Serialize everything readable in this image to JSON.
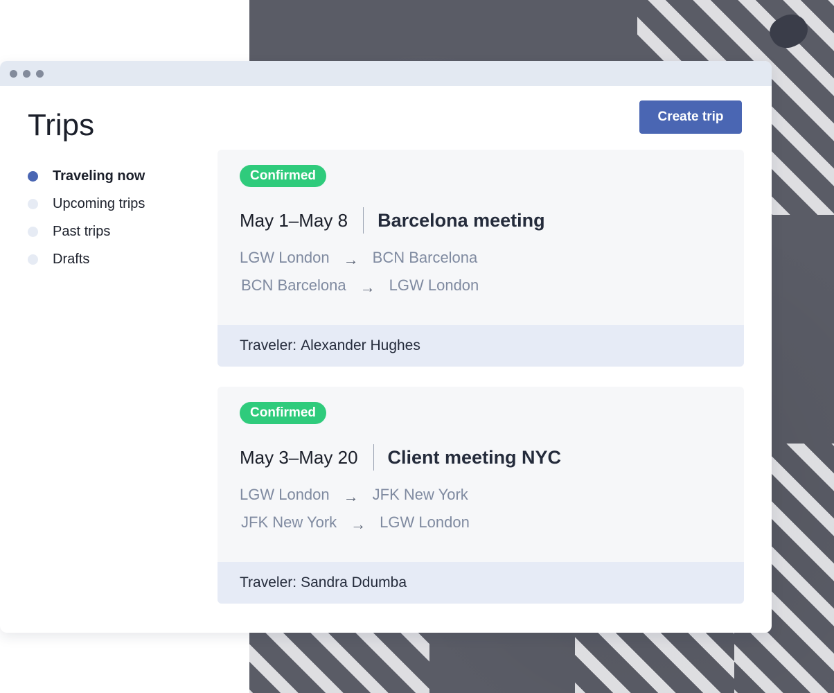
{
  "page": {
    "title": "Trips"
  },
  "actions": {
    "create_label": "Create trip"
  },
  "sidebar": {
    "items": [
      {
        "label": "Traveling now",
        "active": true
      },
      {
        "label": "Upcoming trips",
        "active": false
      },
      {
        "label": "Past trips",
        "active": false
      },
      {
        "label": "Drafts",
        "active": false
      }
    ]
  },
  "trips": [
    {
      "status": "Confirmed",
      "dates": "May 1–May 8",
      "name": "Barcelona meeting",
      "legs": [
        {
          "from": "LGW London",
          "to": "BCN Barcelona"
        },
        {
          "from": "BCN Barcelona",
          "to": "LGW London"
        }
      ],
      "traveler_label": "Traveler:",
      "traveler": "Alexander Hughes"
    },
    {
      "status": "Confirmed",
      "dates": "May 3–May 20",
      "name": "Client meeting NYC",
      "legs": [
        {
          "from": "LGW London",
          "to": "JFK New York"
        },
        {
          "from": "JFK New York",
          "to": "LGW London"
        }
      ],
      "traveler_label": "Traveler:",
      "traveler": "Sandra Ddumba"
    }
  ],
  "icons": {
    "route_arrow": "arrow-right-icon",
    "window_controls": "window-dot-icon"
  },
  "colors": {
    "accent": "#4a66b3",
    "status_confirmed": "#2fcb7c",
    "card_background": "#f6f7f9",
    "card_footer": "#e6ebf6",
    "titlebar": "#e3e9f2"
  }
}
